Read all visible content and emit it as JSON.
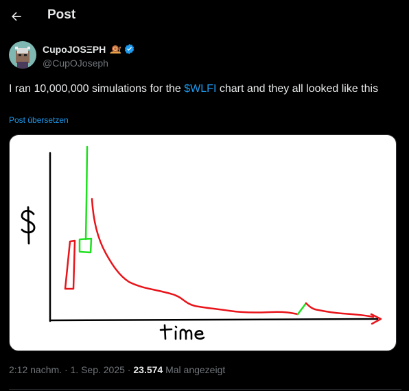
{
  "header": {
    "title": "Post",
    "back_icon": "arrow-left-icon"
  },
  "author": {
    "display_name": "CupoJOSΞPH",
    "handle": "@CupOJoseph",
    "badge_emoji": "snail-icon",
    "verified_icon": "verified-badge-icon",
    "verified_color": "#1d9bf0"
  },
  "tweet": {
    "text_before": "I ran 10,000,000 simulations for the ",
    "cashtag": "$WLFI",
    "text_after": " chart and they all looked like this",
    "translate_label": "Post übersetzen"
  },
  "media": {
    "y_label": "$",
    "x_label": "time",
    "colors": {
      "red": "#e8141a",
      "green": "#1ee01e",
      "axes": "#000000"
    }
  },
  "meta": {
    "time": "2:12 nachm.",
    "separator": " · ",
    "date": "1. Sep. 2025",
    "views_count": "23.574",
    "views_label": " Mal angezeigt"
  },
  "colors": {
    "background": "#000000",
    "text_primary": "#e7e9ea",
    "text_secondary": "#71767b",
    "accent": "#1d9bf0"
  }
}
